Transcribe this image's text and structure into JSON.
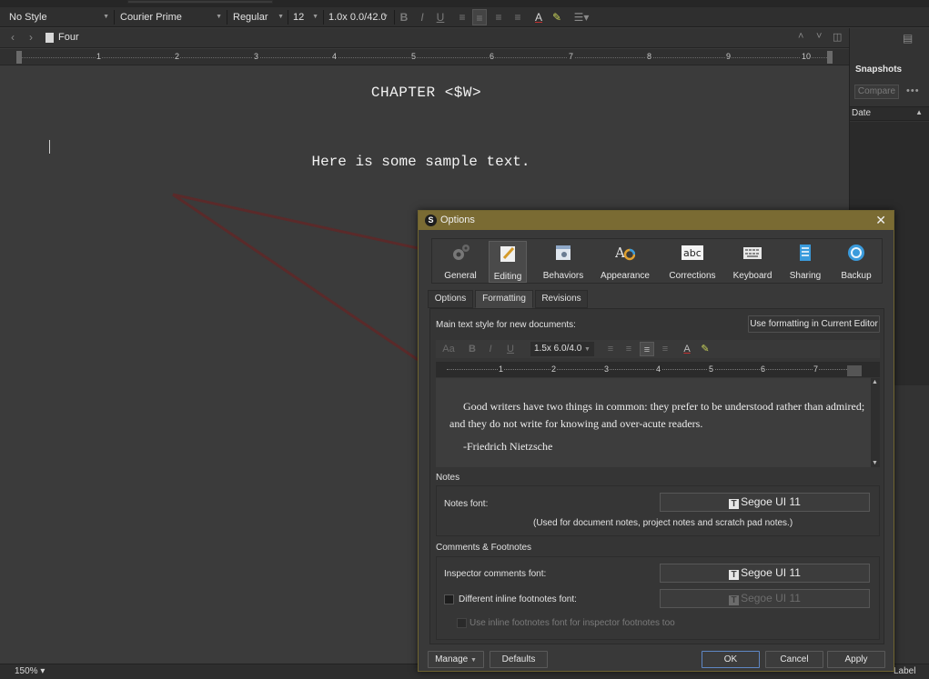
{
  "format_bar": {
    "style": "No Style",
    "font": "Courier Prime",
    "weight": "Regular",
    "size": "12",
    "spacing": "1.0x 0.0/42.0",
    "bold": "B",
    "italic": "I",
    "underline": "U"
  },
  "header": {
    "doc_title": "Four"
  },
  "ruler": {
    "ticks": [
      "1",
      "2",
      "3",
      "4",
      "5",
      "6",
      "7",
      "8",
      "9",
      "10"
    ]
  },
  "editor": {
    "title": "CHAPTER <$W>",
    "body": "Here is some sample text."
  },
  "inspector": {
    "heading": "Snapshots",
    "compare": "Compare",
    "more": "•••",
    "date_header": "Date"
  },
  "status": {
    "zoom": "150%",
    "label": "Label"
  },
  "dialog": {
    "title": "Options",
    "close": "✕",
    "categories": [
      "General",
      "Editing",
      "Behaviors",
      "Appearance",
      "Corrections",
      "Keyboard",
      "Sharing",
      "Backup"
    ],
    "active_category": "Editing",
    "tabs": [
      "Options",
      "Formatting",
      "Revisions"
    ],
    "active_tab": "Formatting",
    "main_style_label": "Main text style for new documents:",
    "use_formatting": "Use formatting in Current Editor",
    "mini_spacing": "1.5x 6.0/4.0",
    "mini_ruler_ticks": [
      "1",
      "2",
      "3",
      "4",
      "5",
      "6",
      "7"
    ],
    "preview_line1": "Good writers have two things in common: they prefer to be understood rather than admired;",
    "preview_line2": "and they do not write for knowing and over-acute readers.",
    "preview_line3": "-Friedrich Nietzsche",
    "notes_heading": "Notes",
    "notes_font_label": "Notes font:",
    "notes_font_value": "Segoe UI 11",
    "notes_help": "(Used for document notes, project notes and scratch pad notes.)",
    "comments_heading": "Comments & Footnotes",
    "inspector_font_label": "Inspector comments font:",
    "inspector_font_value": "Segoe UI 11",
    "inline_label": "Different inline footnotes font:",
    "inline_value": "Segoe UI 11",
    "inline_inspector_label": "Use inline footnotes font for inspector footnotes too",
    "manage": "Manage",
    "defaults": "Defaults",
    "ok": "OK",
    "cancel": "Cancel",
    "apply": "Apply"
  },
  "colors": {
    "titlebar": "#7a6b33",
    "arrow": "#5a2a2a",
    "accent": "#3a9bdc"
  }
}
